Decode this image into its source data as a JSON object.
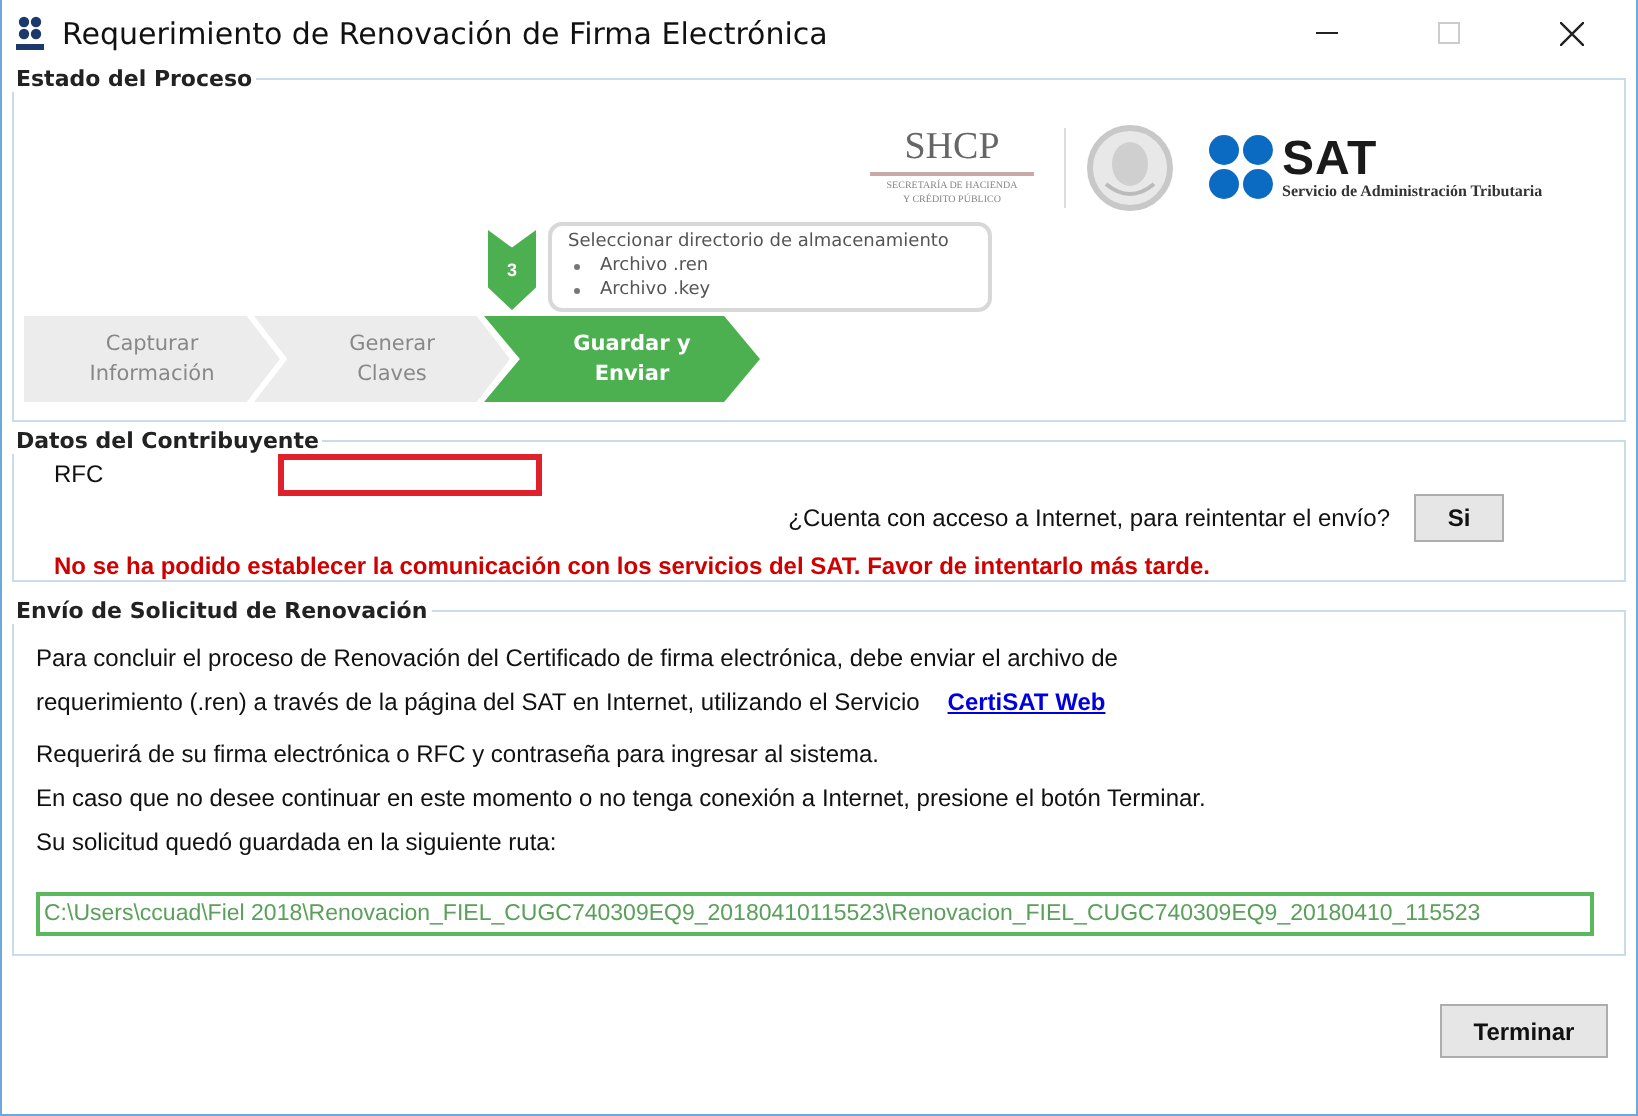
{
  "window": {
    "title": "Requerimiento de Renovación de Firma Electrónica",
    "controls": [
      {
        "kind": "minimize",
        "disabled": false
      },
      {
        "kind": "maximize",
        "disabled": true
      },
      {
        "kind": "close",
        "disabled": false
      }
    ]
  },
  "process": {
    "legend": "Estado del Proceso",
    "logos": {
      "shcp": "SHCP",
      "shcp_line_1": "SECRETARÍA DE HACIENDA",
      "shcp_line_2": "Y CRÉDITO PÚBLICO",
      "sat": "SAT",
      "sat_subtitle": "Servicio de Administración Tributaria"
    },
    "step_badge": "3",
    "callout": {
      "title": "Seleccionar directorio de almacenamiento",
      "items": [
        "Archivo .ren",
        "Archivo .key"
      ]
    },
    "steps": [
      {
        "label": "Capturar Información",
        "selected": false
      },
      {
        "label": "Generar Claves",
        "selected": false
      },
      {
        "label": "Guardar y Enviar",
        "selected": true
      }
    ]
  },
  "taxpayer": {
    "legend": "Datos del Contribuyente",
    "rfc_label": "RFC",
    "rfc_field": {
      "error": true
    },
    "question": "¿Cuenta con acceso a Internet, para reintentar el envío?",
    "retry_button": "Si",
    "error_message": "No se ha podido establecer la comunicación con los servicios del SAT. Favor de intentarlo más tarde."
  },
  "submission": {
    "legend": "Envío de Solicitud de Renovación",
    "lines": [
      {
        "text": "Para concluir el proceso de Renovación del Certificado de firma electrónica, debe enviar el archivo de"
      },
      {
        "text": "requerimiento (.ren) a través de la página del SAT en Internet, utilizando el Servicio",
        "link": "CertiSAT Web"
      },
      {
        "text": "Requerirá  de su firma electrónica o RFC y contraseña para ingresar al sistema."
      },
      {
        "text": "En caso que no desee continuar en este momento o no tenga conexión a Internet, presione el botón Terminar."
      },
      {
        "text": "Su solicitud quedó guardada en la siguiente ruta:"
      }
    ],
    "path": "C:\\Users\\ccuad\\Fiel 2018\\Renovacion_FIEL_CUGC740309EQ9_20180410115523\\Renovacion_FIEL_CUGC740309EQ9_20180410_115523"
  },
  "footer": {
    "finish_button": "Terminar"
  }
}
